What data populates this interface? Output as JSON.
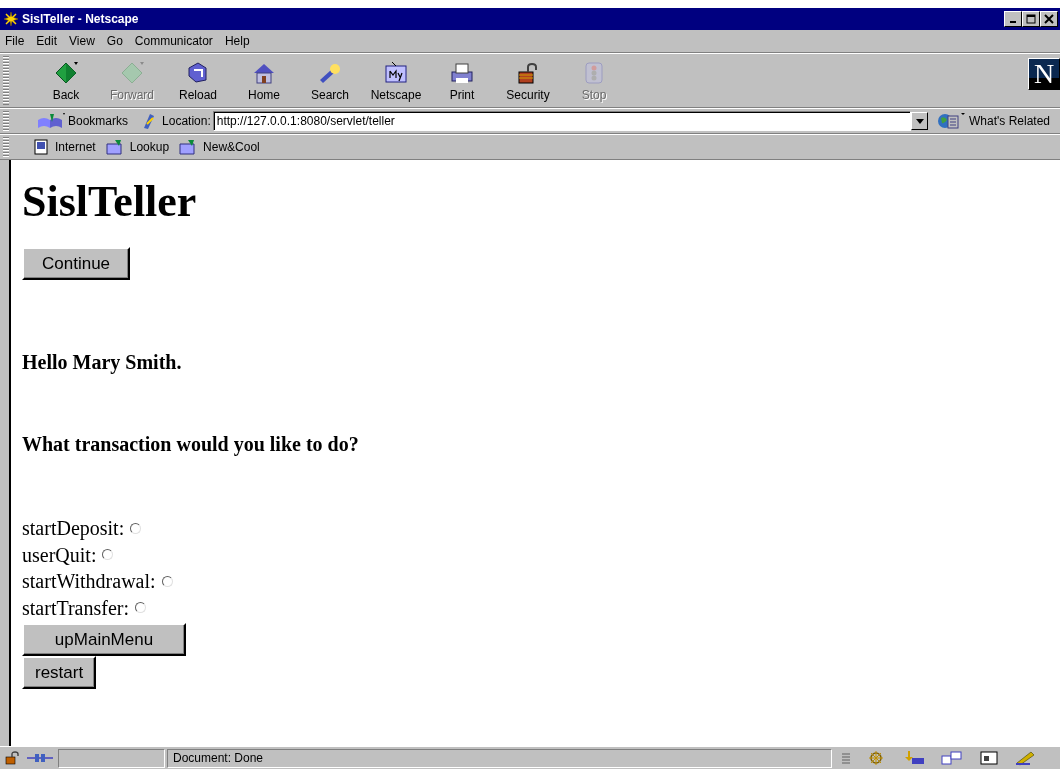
{
  "window": {
    "title": "SislTeller - Netscape"
  },
  "menu": [
    "File",
    "Edit",
    "View",
    "Go",
    "Communicator",
    "Help"
  ],
  "toolbar": [
    {
      "label": "Back",
      "kind": "back",
      "disabled": false
    },
    {
      "label": "Forward",
      "kind": "forward",
      "disabled": true
    },
    {
      "label": "Reload",
      "kind": "reload",
      "disabled": false
    },
    {
      "label": "Home",
      "kind": "home",
      "disabled": false
    },
    {
      "label": "Search",
      "kind": "search",
      "disabled": false
    },
    {
      "label": "Netscape",
      "kind": "netscape",
      "disabled": false
    },
    {
      "label": "Print",
      "kind": "print",
      "disabled": false
    },
    {
      "label": "Security",
      "kind": "security",
      "disabled": false
    },
    {
      "label": "Stop",
      "kind": "stop",
      "disabled": true
    }
  ],
  "logo": {
    "letter": "N"
  },
  "location_bar": {
    "bookmarks": "Bookmarks",
    "label": "Location:",
    "url": "http://127.0.0.1:8080/servlet/teller",
    "related": "What's Related"
  },
  "personal_toolbar": [
    {
      "label": "Internet",
      "kind": "page"
    },
    {
      "label": "Lookup",
      "kind": "folder"
    },
    {
      "label": "New&Cool",
      "kind": "folder"
    }
  ],
  "page": {
    "heading": "SislTeller",
    "continue_button": "Continue",
    "greeting": "Hello Mary Smith.",
    "question": "What transaction would you like to do?",
    "options": [
      {
        "label": "startDeposit:",
        "selected": false
      },
      {
        "label": "userQuit:",
        "selected": false
      },
      {
        "label": "startWithdrawal:",
        "selected": false
      },
      {
        "label": "startTransfer:",
        "selected": false
      }
    ],
    "buttons": [
      "upMainMenu",
      "restart"
    ]
  },
  "status_bar": {
    "text": "Document: Done"
  }
}
